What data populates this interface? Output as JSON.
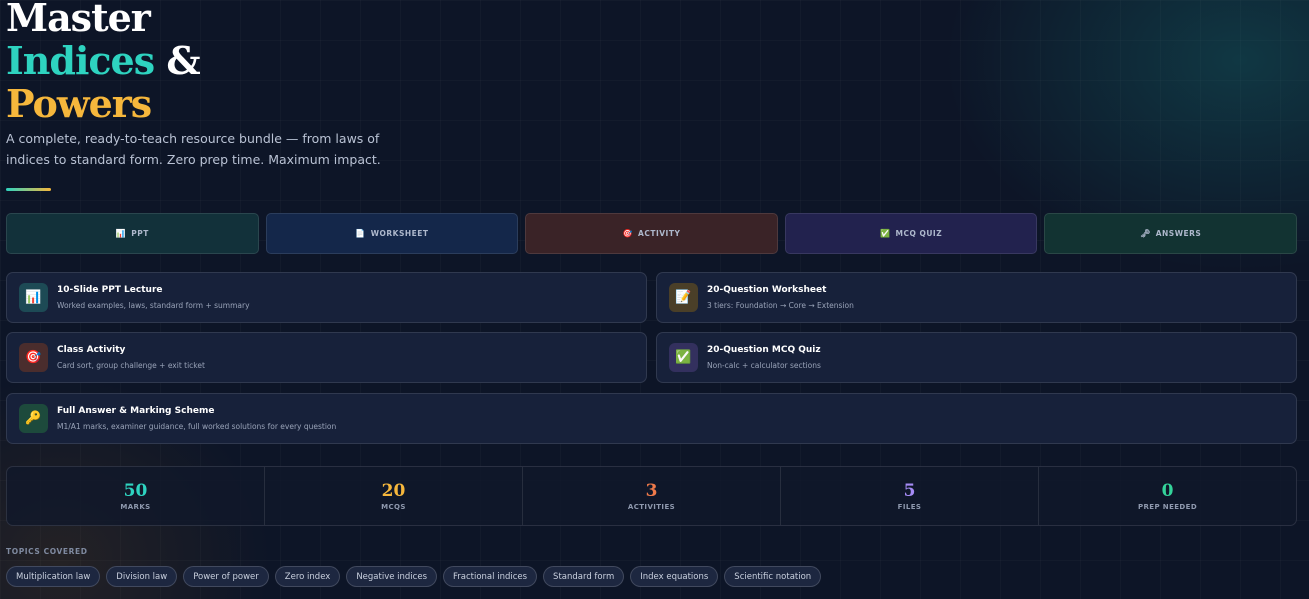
{
  "hero": {
    "title_line1": "Master",
    "title_line2_a": "Indices",
    "title_line2_b": "&",
    "title_line3": "Powers",
    "subtitle": "A complete, ready-to-teach resource bundle — from laws of indices to standard form. Zero prep time. Maximum impact."
  },
  "tabs": [
    {
      "icon": "📊",
      "label": "PPT"
    },
    {
      "icon": "📄",
      "label": "WORKSHEET"
    },
    {
      "icon": "🎯",
      "label": "ACTIVITY"
    },
    {
      "icon": "✅",
      "label": "MCQ QUIZ"
    },
    {
      "icon": "🗝",
      "label": "ANSWERS"
    }
  ],
  "cards": [
    {
      "icon": "📊",
      "title": "10-Slide PPT Lecture",
      "desc": "Worked examples, laws, standard form + summary",
      "color": "#1d4a55"
    },
    {
      "icon": "📝",
      "title": "20-Question Worksheet",
      "desc": "3 tiers: Foundation → Core → Extension",
      "color": "#4a3f28"
    },
    {
      "icon": "🎯",
      "title": "Class Activity",
      "desc": "Card sort, group challenge + exit ticket",
      "color": "#4a2d2d"
    },
    {
      "icon": "✅",
      "title": "20-Question MCQ Quiz",
      "desc": "Non-calc + calculator sections",
      "color": "#33305e"
    },
    {
      "icon": "🔑",
      "title": "Full Answer & Marking Scheme",
      "desc": "M1/A1 marks, examiner guidance, full worked solutions for every question",
      "color": "#1d4a3c"
    }
  ],
  "stats": [
    {
      "value": "50",
      "label": "MARKS",
      "color": "#2ed3c0"
    },
    {
      "value": "20",
      "label": "MCQS",
      "color": "#f6b73c"
    },
    {
      "value": "3",
      "label": "ACTIVITIES",
      "color": "#ef7a4a"
    },
    {
      "value": "5",
      "label": "FILES",
      "color": "#a58bf5"
    },
    {
      "value": "0",
      "label": "PREP NEEDED",
      "color": "#34d39a"
    }
  ],
  "topics": {
    "heading": "TOPICS COVERED",
    "items": [
      "Multiplication law",
      "Division law",
      "Power of power",
      "Zero index",
      "Negative indices",
      "Fractional indices",
      "Standard form",
      "Index equations",
      "Scientific notation"
    ]
  }
}
